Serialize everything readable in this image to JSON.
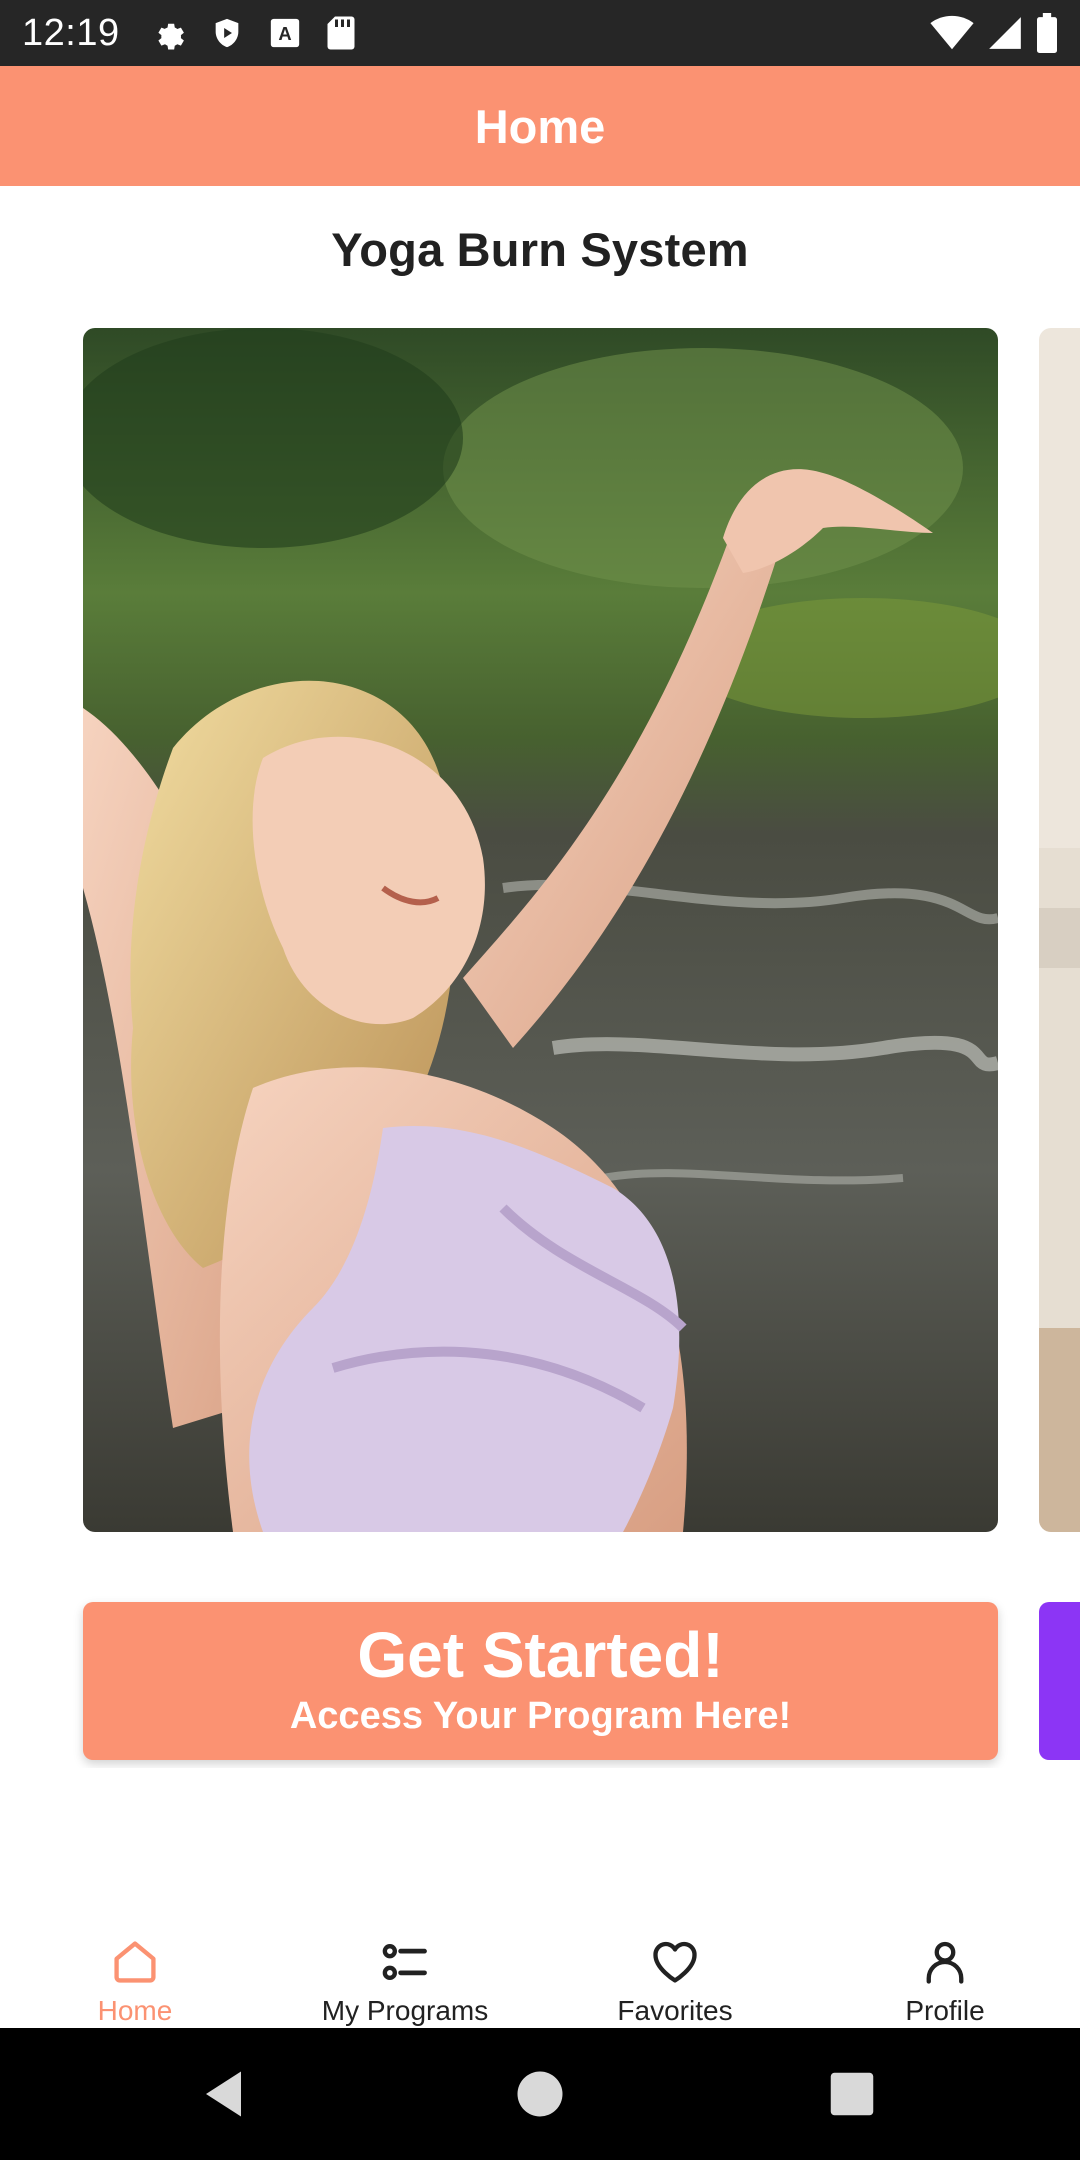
{
  "status_bar": {
    "time": "12:19",
    "left_icons": [
      "gear-icon",
      "shield-icon",
      "keyboard-icon",
      "sd-card-icon"
    ],
    "right_icons": [
      "wifi-icon",
      "cellular-signal-icon",
      "battery-icon"
    ]
  },
  "app_bar": {
    "title": "Home"
  },
  "section_title": "Yoga Burn System",
  "carousel": {
    "cta_title": "Get Started!",
    "cta_subtitle": "Access Your Program Here!"
  },
  "bottom_nav": {
    "items": [
      {
        "label": "Home",
        "icon": "home-icon",
        "active": true
      },
      {
        "label": "My Programs",
        "icon": "list-icon",
        "active": false
      },
      {
        "label": "Favorites",
        "icon": "heart-icon",
        "active": false
      },
      {
        "label": "Profile",
        "icon": "person-icon",
        "active": false
      }
    ]
  },
  "system_nav": {
    "buttons": [
      "back-icon",
      "home-circle-icon",
      "recents-icon"
    ]
  },
  "colors": {
    "accent": "#fb9272",
    "purple": "#8c35f5",
    "status_bar": "#262626",
    "text": "#212121"
  }
}
